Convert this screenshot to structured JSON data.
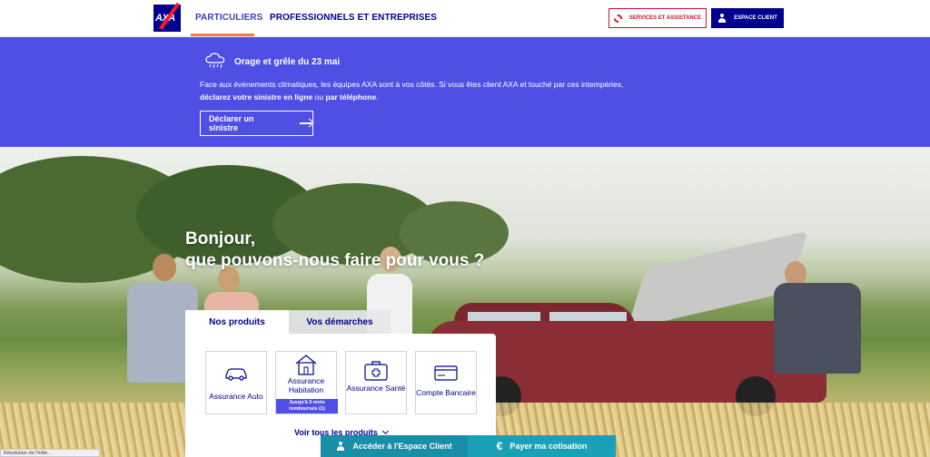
{
  "header": {
    "logo_text": "AXA",
    "nav": [
      "PARTICULIERS",
      "PROFESSIONNELS ET ENTREPRISES"
    ],
    "services_label": "SERVICES ET ASSISTANCE",
    "client_label": "ESPACE CLIENT"
  },
  "alert": {
    "title": "Orage et grêle du 23 mai",
    "text_1": "Face aux évènements climatiques, les équipes AXA sont à vos côtés. Si vous êtes client AXA et touché par ces intempéries,",
    "text_bold_1": "déclarez votre sinistre en ligne",
    "text_mid": " ou ",
    "text_bold_2": "par téléphone",
    "text_end": ".",
    "button_label": "Déclarer un sinistre"
  },
  "hero": {
    "title_line1": "Bonjour,",
    "title_line2": "que pouvons-nous faire pour vous ?"
  },
  "widget": {
    "tabs": [
      "Nos produits",
      "Vos démarches"
    ],
    "products": [
      {
        "label": "Assurance Auto",
        "icon": "car-icon"
      },
      {
        "label": "Assurance Habitation",
        "icon": "house-icon",
        "badge": "Jusqu'à 5 mois remboursés (1)"
      },
      {
        "label": "Assurance Santé",
        "icon": "medical-kit-icon"
      },
      {
        "label": "Compte Bancaire",
        "icon": "bank-card-icon"
      }
    ],
    "see_all": "Voir tous les produits"
  },
  "bottom_bar": {
    "client_label": "Accéder à l'Espace Client",
    "pay_label": "Payer ma cotisation"
  },
  "status_text": "Résolution de l'hôte...",
  "colors": {
    "brand_blue": "#00008f",
    "alert_blue": "#4f4fe6",
    "accent_red": "#c91432",
    "teal": "#1a8da7"
  }
}
